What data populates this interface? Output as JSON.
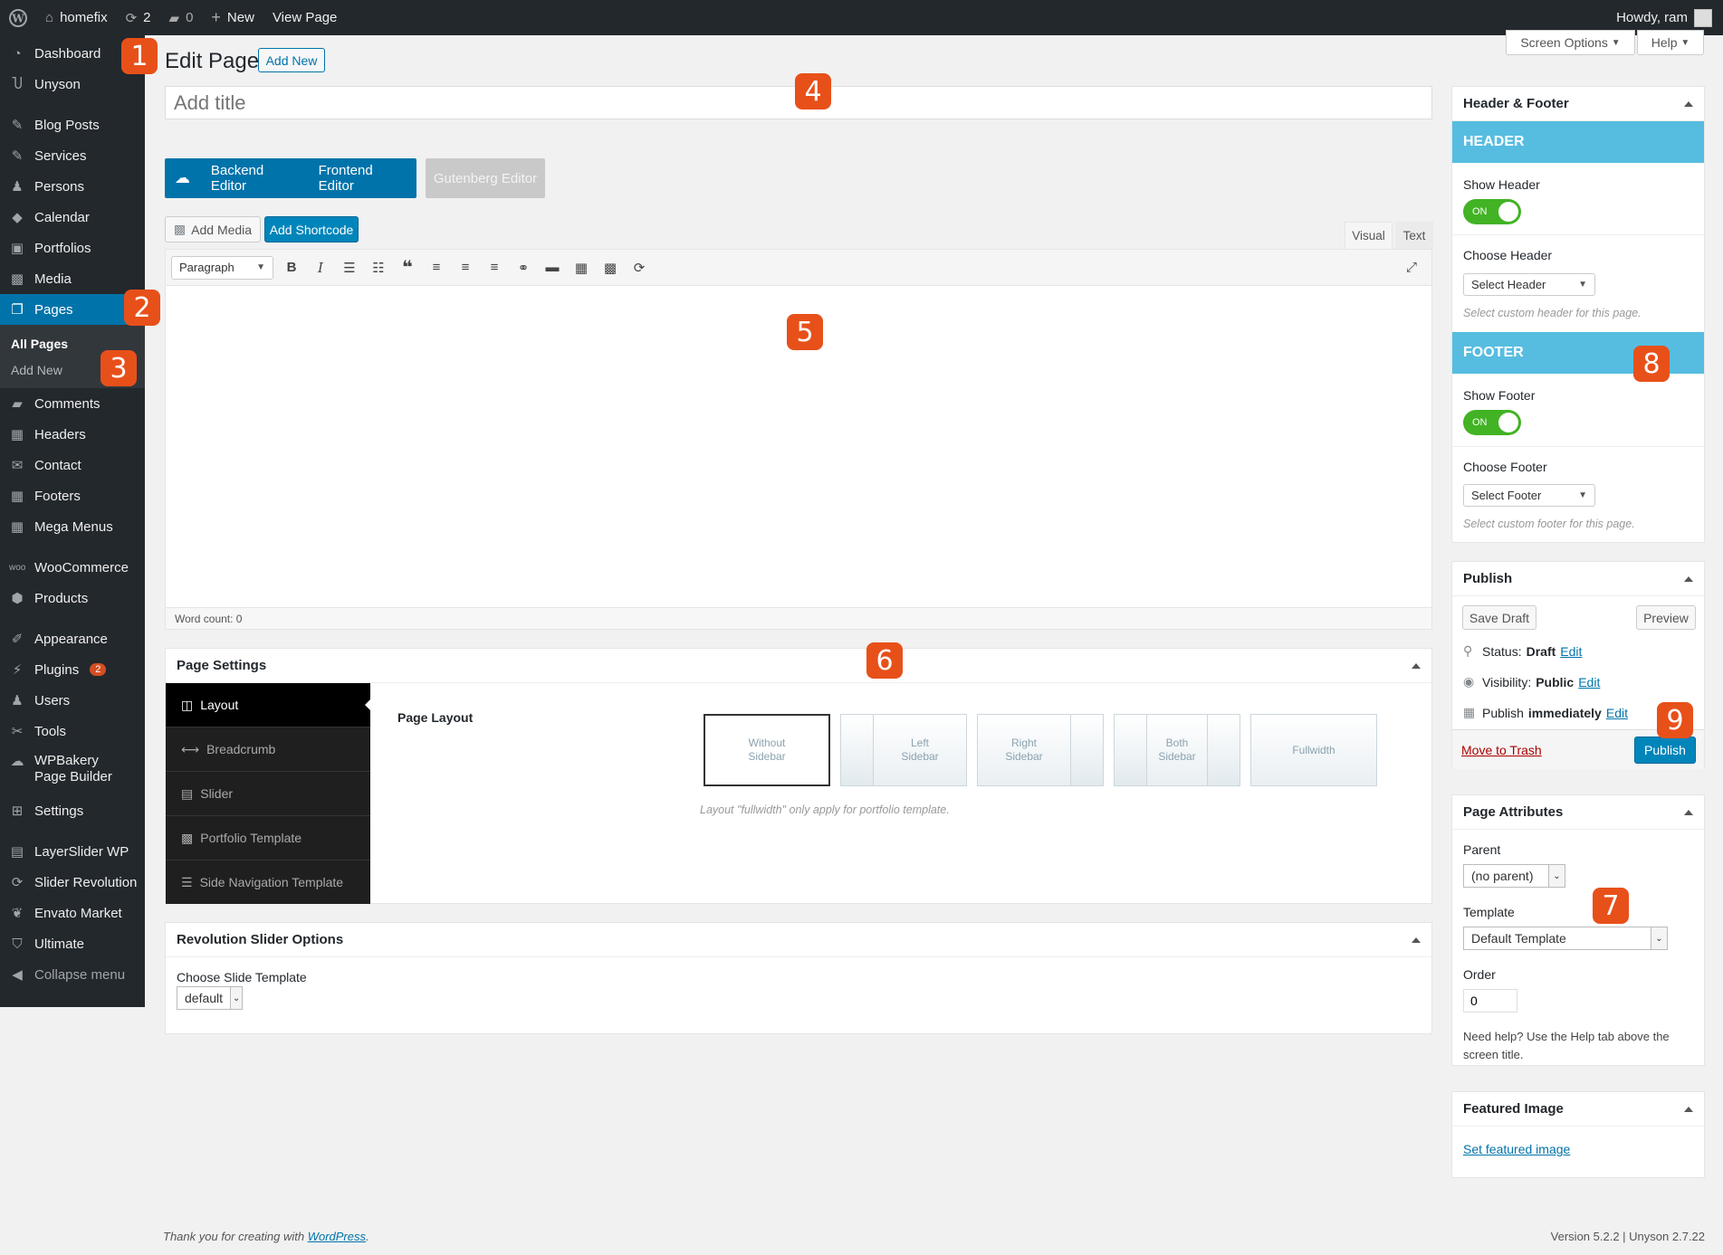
{
  "admin_bar": {
    "site_name": "homefix",
    "updates_count": "2",
    "comments_count": "0",
    "new_label": "New",
    "view_page_label": "View Page",
    "howdy_label": "Howdy, ram"
  },
  "sidebar": {
    "dashboard": "Dashboard",
    "unyson": "Unyson",
    "blog_posts": "Blog Posts",
    "services": "Services",
    "persons": "Persons",
    "calendar": "Calendar",
    "portfolios": "Portfolios",
    "media": "Media",
    "pages": "Pages",
    "all_pages": "All Pages",
    "add_new": "Add New",
    "comments": "Comments",
    "headers": "Headers",
    "contact": "Contact",
    "footers": "Footers",
    "mega_menus": "Mega Menus",
    "woocommerce": "WooCommerce",
    "products": "Products",
    "appearance": "Appearance",
    "plugins": "Plugins",
    "plugins_badge": "2",
    "users": "Users",
    "tools": "Tools",
    "wpbakery": "WPBakery Page Builder",
    "settings": "Settings",
    "layerslider": "LayerSlider WP",
    "slider_revolution": "Slider Revolution",
    "envato_market": "Envato Market",
    "ultimate": "Ultimate",
    "collapse_menu": "Collapse menu"
  },
  "annotations": [
    "1",
    "2",
    "3",
    "4",
    "5",
    "6",
    "7",
    "8",
    "9"
  ],
  "screen_meta": {
    "screen_options": "Screen Options",
    "help": "Help"
  },
  "page": {
    "heading": "Edit Page",
    "add_new": "Add New",
    "title_placeholder": "Add title"
  },
  "editor_switch": {
    "backend": "Backend Editor",
    "frontend": "Frontend Editor",
    "gutenberg": "Gutenberg Editor"
  },
  "editor": {
    "add_media": "Add Media",
    "add_shortcode": "Add Shortcode",
    "tab_visual": "Visual",
    "tab_text": "Text",
    "format_select": "Paragraph",
    "word_count": "Word count: 0"
  },
  "page_settings": {
    "title": "Page Settings",
    "tabs": [
      "Layout",
      "Breadcrumb",
      "Slider",
      "Portfolio Template",
      "Side Navigation Template"
    ],
    "page_layout_label": "Page Layout",
    "layouts": [
      "Without Sidebar",
      "Left Sidebar",
      "Right Sidebar",
      "Both Sidebar",
      "Fullwidth"
    ],
    "layout_hint": "Layout \"fullwidth\" only apply for portfolio template."
  },
  "rev_slider": {
    "title": "Revolution Slider Options",
    "choose_label": "Choose Slide Template",
    "value": "default"
  },
  "header_footer": {
    "title": "Header & Footer",
    "header_band": "HEADER",
    "show_header": "Show Header",
    "toggle_on": "ON",
    "choose_header": "Choose Header",
    "select_header": "Select Header",
    "header_hint": "Select custom header for this page.",
    "footer_band": "FOOTER",
    "show_footer": "Show Footer",
    "choose_footer": "Choose Footer",
    "select_footer": "Select Footer",
    "footer_hint": "Select custom footer for this page.",
    "band_color": "#56bde0"
  },
  "publish": {
    "title": "Publish",
    "save_draft": "Save Draft",
    "preview": "Preview",
    "status_label": "Status:",
    "status_value": "Draft",
    "visibility_label": "Visibility:",
    "visibility_value": "Public",
    "publish_label": "Publish",
    "publish_value": "immediately",
    "edit": "Edit",
    "move_to_trash": "Move to Trash",
    "publish_button": "Publish"
  },
  "page_attributes": {
    "title": "Page Attributes",
    "parent_label": "Parent",
    "parent_value": "(no parent)",
    "template_label": "Template",
    "template_value": "Default Template",
    "order_label": "Order",
    "order_value": "0",
    "help_text": "Need help? Use the Help tab above the screen title."
  },
  "featured_image": {
    "title": "Featured Image",
    "set_link": "Set featured image"
  },
  "footer": {
    "thanks_prefix": "Thank you for creating with",
    "wordpress_link": "WordPress",
    "version": "Version 5.2.2 | Unyson 2.7.22"
  }
}
